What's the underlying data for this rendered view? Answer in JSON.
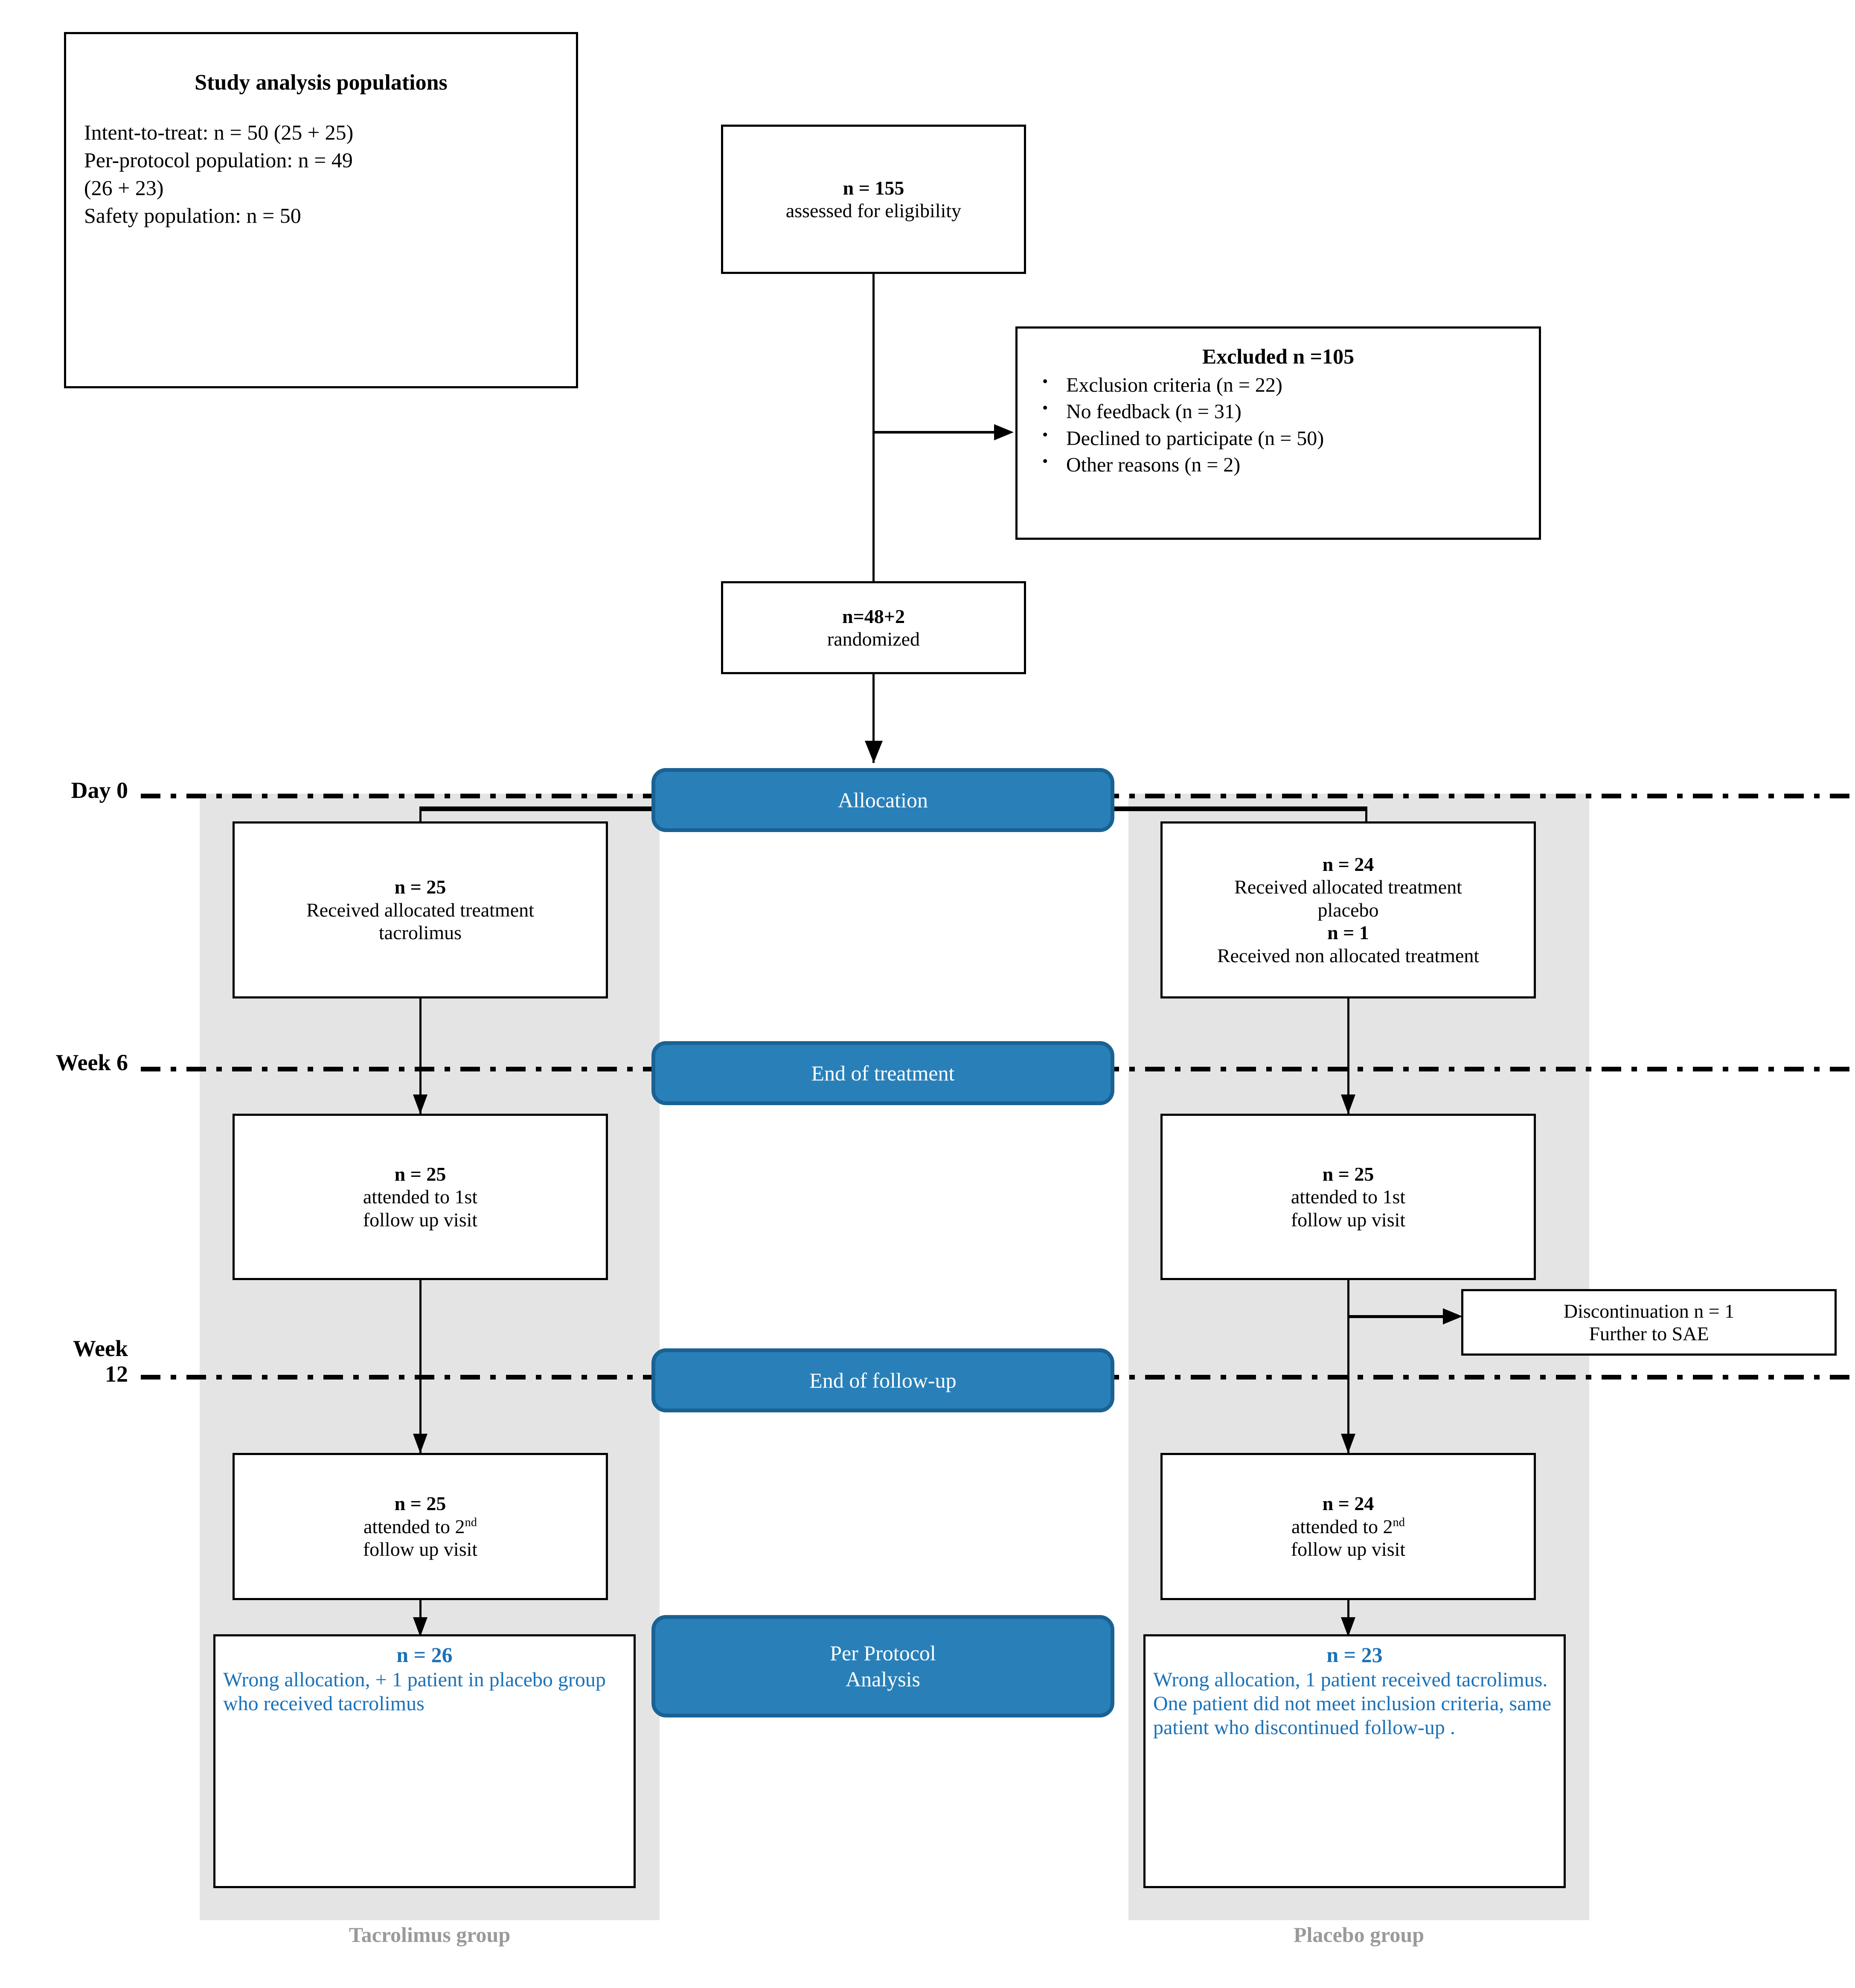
{
  "colors": {
    "banner_fill": "#2980b9",
    "banner_border": "#1a6294",
    "lane_gray": "#e4e4e4",
    "per_protocol_text": "#1b72b8",
    "group_caption": "#9a9a9a",
    "line_black": "#000000"
  },
  "info_box": {
    "title": "Study analysis populations",
    "lines": [
      "Intent-to-treat: n = 50 (25 + 25)",
      "Per-protocol population: n = 49",
      "(26 + 23)",
      "Safety population: n = 50"
    ]
  },
  "enrollment": {
    "assessed": {
      "n": "n = 155",
      "label": "assessed for eligibility"
    },
    "randomized": {
      "n": "n=48+2",
      "label": "randomized"
    }
  },
  "excluded": {
    "title": "Excluded  n =105",
    "items": [
      "Exclusion criteria (n = 22)",
      "No feedback (n = 31)",
      "Declined to participate (n = 50)",
      "Other reasons (n = 2)"
    ]
  },
  "timepoints": {
    "day0": "Day 0",
    "week6": "Week 6",
    "week12_line1": "Week",
    "week12_line2": "12"
  },
  "banners": {
    "allocation": "Allocation",
    "end_of_treatment": "End of treatment",
    "end_of_followup": "End of follow-up",
    "per_protocol_line1": "Per Protocol",
    "per_protocol_line2": "Analysis"
  },
  "tacrolimus_arm": {
    "group_caption": "Tacrolimus group",
    "allocation": {
      "n": "n = 25",
      "label": "Received allocated treatment tacrolimus"
    },
    "followup1": {
      "n": "n = 25",
      "label_a": "attended to 1st",
      "label_b": "follow up visit"
    },
    "followup2": {
      "n": "n = 25",
      "label_a": "attended to 2",
      "label_sup": "nd",
      "label_b": "follow up visit"
    },
    "per_protocol": {
      "n": "n = 26",
      "text": "Wrong allocation, + 1 patient in placebo group who received tacrolimus"
    }
  },
  "placebo_arm": {
    "group_caption": "Placebo group",
    "allocation": {
      "n1": "n = 24",
      "label1": "Received allocated treatment placebo",
      "n2": "n = 1",
      "label2": "Received non allocated treatment"
    },
    "followup1": {
      "n": "n = 25",
      "label_a": "attended to 1st",
      "label_b": "follow up visit"
    },
    "followup2": {
      "n": "n = 24",
      "label_a": "attended to 2",
      "label_sup": "nd",
      "label_b": "follow up visit"
    },
    "per_protocol": {
      "n": "n = 23",
      "text": "Wrong allocation, 1 patient received tacrolimus. One patient did not meet inclusion criteria, same patient who discontinued follow-up ."
    }
  },
  "discontinuation": {
    "line1": "Discontinuation n = 1",
    "line2": "Further to SAE"
  }
}
